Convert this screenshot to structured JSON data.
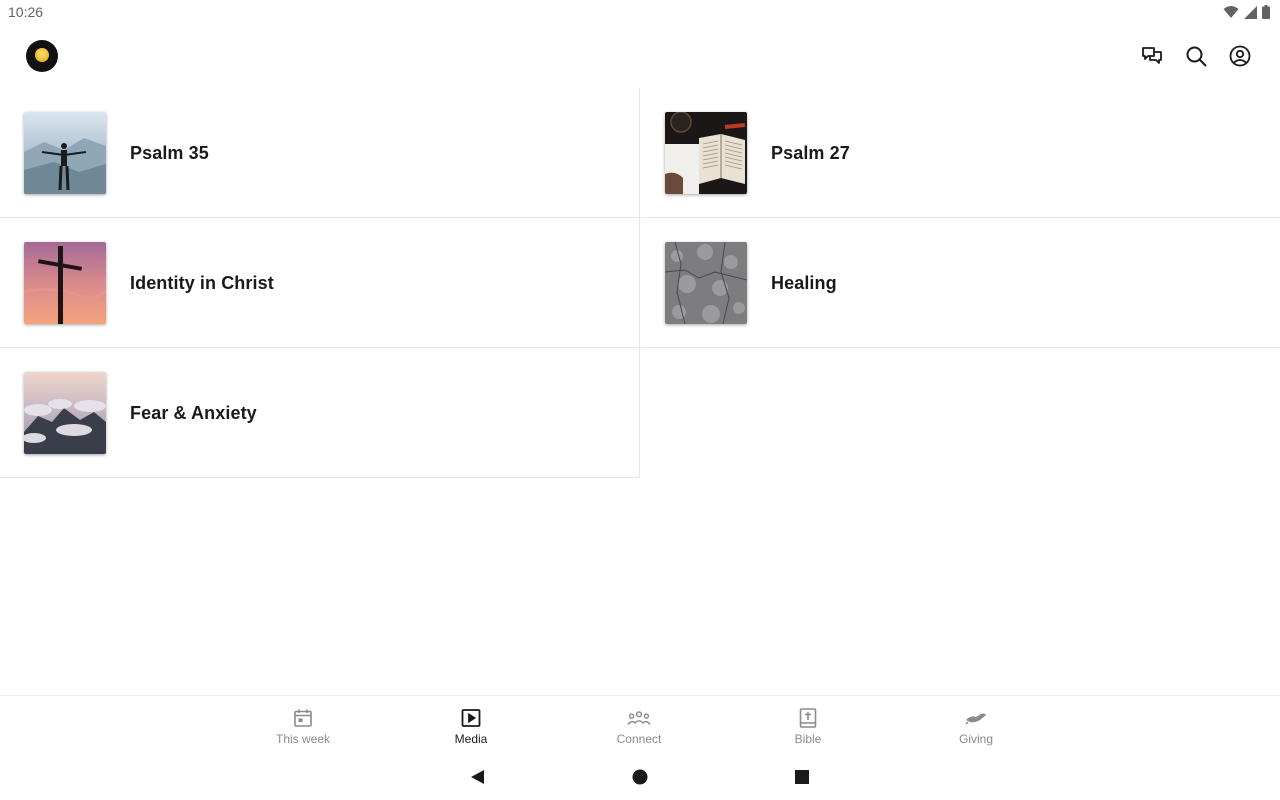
{
  "status_bar": {
    "time": "10:26"
  },
  "app_bar": {
    "logo": "church-logo",
    "actions": [
      "chat-icon",
      "search-icon",
      "account-icon"
    ]
  },
  "media_items": [
    {
      "title": "Psalm 35",
      "thumbnail": "person-on-mountain-image"
    },
    {
      "title": "Psalm 27",
      "thumbnail": "open-bible-coffee-image"
    },
    {
      "title": "Identity in Christ",
      "thumbnail": "cross-sunset-image"
    },
    {
      "title": "Healing",
      "thumbnail": "grey-texture-image"
    },
    {
      "title": "Fear & Anxiety",
      "thumbnail": "clouds-mountain-image"
    }
  ],
  "bottom_nav": {
    "active": "Media",
    "items": [
      {
        "label": "This week",
        "icon": "calendar-icon"
      },
      {
        "label": "Media",
        "icon": "play-icon"
      },
      {
        "label": "Connect",
        "icon": "group-icon"
      },
      {
        "label": "Bible",
        "icon": "bible-icon"
      },
      {
        "label": "Giving",
        "icon": "giving-hand-icon"
      }
    ]
  },
  "colors": {
    "divider": "#e6e6e6",
    "text": "#1a1a1a",
    "inactive": "#8a8a8a"
  }
}
